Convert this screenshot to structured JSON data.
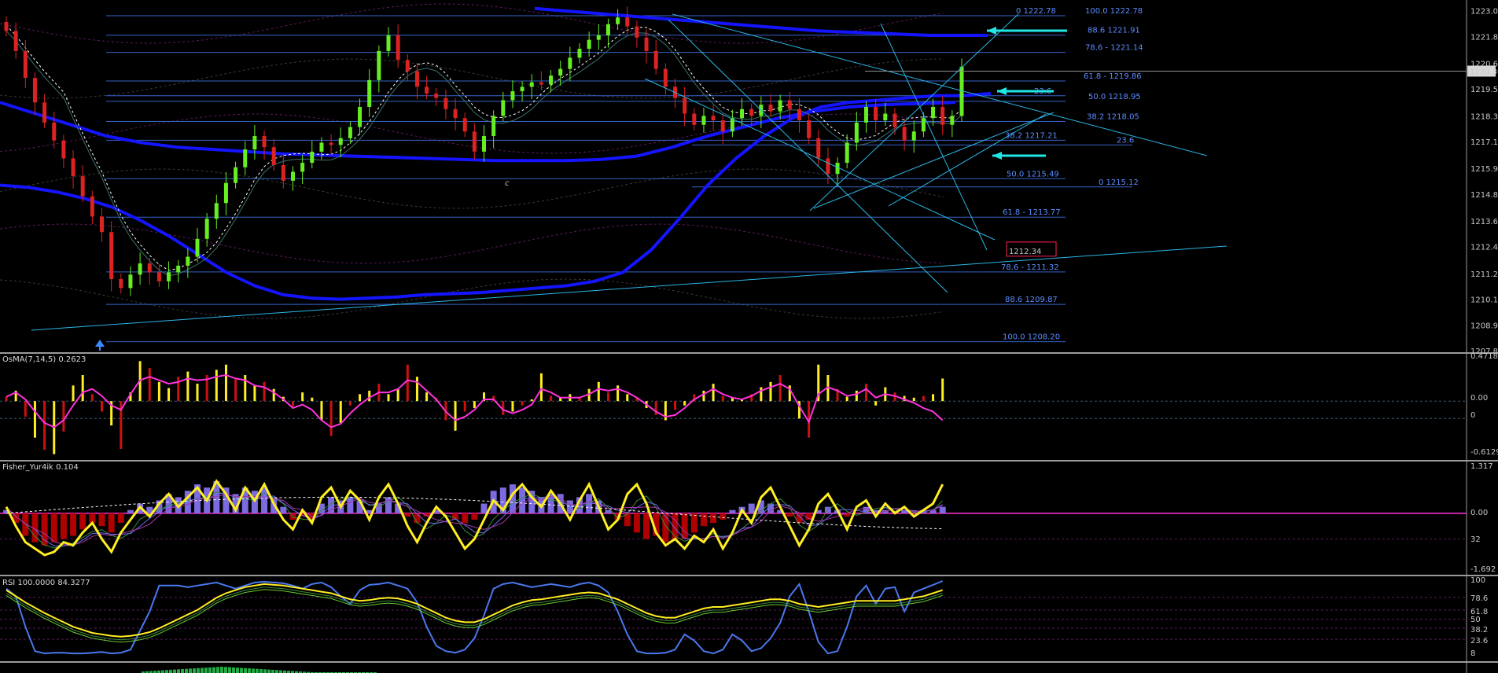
{
  "chart_data": [
    {
      "type": "candlestick",
      "pane": "main",
      "ylim": [
        1207.8,
        1223.2
      ],
      "y_ticks": [
        "1223.00",
        "1221.85",
        "1220.65",
        "1219.50",
        "1218.30",
        "1217.15",
        "1215.95",
        "1214.80",
        "1213.60",
        "1212.45",
        "1211.25",
        "1210.10",
        "1208.95",
        "1207.80"
      ],
      "current_price": "1220.30",
      "price_marker": "1212.34",
      "wave_label": "c",
      "fib_levels": [
        {
          "label": "0  1222.78",
          "value": 1222.78
        },
        {
          "label": "100.0  1222.78",
          "value": 1222.78
        },
        {
          "label": "88.6  1221.91",
          "value": 1221.91
        },
        {
          "label": "78.6 - 1221.14",
          "value": 1221.14
        },
        {
          "label": "61.8 - 1219.86",
          "value": 1219.86
        },
        {
          "label": "23.6",
          "value": 1219.2
        },
        {
          "label": "50.0  1218.95",
          "value": 1218.95
        },
        {
          "label": "38.2  1218.05",
          "value": 1218.05
        },
        {
          "label": "38.2  1217.21",
          "value": 1217.21
        },
        {
          "label": "23.6",
          "value": 1217.0
        },
        {
          "label": "50.0  1215.49",
          "value": 1215.49
        },
        {
          "label": "0  1215.12",
          "value": 1215.12
        },
        {
          "label": "61.8 - 1213.77",
          "value": 1213.77
        },
        {
          "label": "78.6 - 1211.32",
          "value": 1211.32
        },
        {
          "label": "88.6  1209.87",
          "value": 1209.87
        },
        {
          "label": "100.0  1208.20",
          "value": 1208.2
        }
      ],
      "close_series": [
        1222.1,
        1221.2,
        1220.0,
        1218.9,
        1218.0,
        1217.2,
        1216.4,
        1215.6,
        1214.7,
        1213.8,
        1213.1,
        1211.0,
        1210.6,
        1211.2,
        1211.7,
        1211.3,
        1210.9,
        1211.3,
        1211.6,
        1212.0,
        1212.8,
        1213.7,
        1214.4,
        1215.3,
        1216.0,
        1216.8,
        1217.4,
        1216.9,
        1216.1,
        1215.4,
        1215.8,
        1216.2,
        1216.7,
        1217.1,
        1217.0,
        1217.3,
        1217.8,
        1218.7,
        1219.9,
        1221.2,
        1221.9,
        1220.8,
        1220.3,
        1219.6,
        1219.3,
        1219.1,
        1218.6,
        1218.2,
        1217.6,
        1216.7,
        1217.4,
        1218.3,
        1219.0,
        1219.4,
        1219.6,
        1219.8,
        1219.7,
        1220.1,
        1220.4,
        1220.9,
        1221.3,
        1221.7,
        1221.9,
        1222.4,
        1222.7,
        1222.3,
        1221.8,
        1221.2,
        1220.4,
        1219.6,
        1219.1,
        1218.4,
        1217.9,
        1218.3,
        1218.1,
        1217.6,
        1218.2,
        1218.6,
        1218.3,
        1218.8,
        1218.5,
        1219.0,
        1218.6,
        1218.1,
        1217.3,
        1216.4,
        1215.7,
        1216.2,
        1217.1,
        1218.0,
        1218.7,
        1218.1,
        1218.4,
        1217.8,
        1217.2,
        1217.6,
        1218.2,
        1218.7,
        1217.9,
        1218.3,
        1220.5
      ],
      "ma_blue": [
        1215.2,
        1215.1,
        1214.9,
        1214.6,
        1214.2,
        1213.6,
        1212.9,
        1212.1,
        1211.3,
        1210.7,
        1210.3,
        1210.15,
        1210.1,
        1210.15,
        1210.2,
        1210.3,
        1210.35,
        1210.4,
        1210.5,
        1210.6,
        1210.7,
        1210.9,
        1211.3,
        1212.3,
        1213.7,
        1215.2,
        1216.4,
        1217.4,
        1218.2,
        1218.7,
        1218.9,
        1219.0,
        1219.1,
        1219.2,
        1219.2,
        1219.3
      ],
      "ma_blue_top": [
        1223.1,
        1223.0,
        1222.9,
        1222.8,
        1222.7,
        1222.6,
        1222.5,
        1222.4,
        1222.3,
        1222.2,
        1222.1,
        1222.05,
        1222.0,
        1221.95,
        1221.9,
        1221.9,
        1221.9
      ],
      "ma_blue_low": [
        1218.9,
        1218.4,
        1217.9,
        1217.4,
        1217.1,
        1216.9,
        1216.8,
        1216.7,
        1216.6,
        1216.55,
        1216.5,
        1216.45,
        1216.4,
        1216.35,
        1216.3,
        1216.3,
        1216.3,
        1216.35,
        1216.5,
        1216.9,
        1217.4,
        1217.8,
        1218.2,
        1218.5,
        1218.7,
        1218.8,
        1218.85,
        1218.9
      ]
    },
    {
      "type": "bar",
      "pane": "osma",
      "title": "OsMA(7,14,5) 0.2623",
      "y_ticks": [
        "0.4718",
        "0.00",
        "0",
        "-0.6129"
      ],
      "ylim": [
        -0.6129,
        0.4718
      ],
      "histogram": [
        0.05,
        0.12,
        -0.18,
        -0.42,
        -0.56,
        -0.61,
        -0.35,
        0.18,
        0.3,
        0.08,
        -0.12,
        -0.28,
        -0.55,
        0.1,
        0.46,
        0.38,
        0.22,
        0.15,
        0.28,
        0.34,
        0.2,
        0.3,
        0.36,
        0.42,
        0.25,
        0.3,
        0.18,
        0.22,
        0.14,
        0.05,
        -0.06,
        0.1,
        0.04,
        -0.22,
        -0.4,
        -0.25,
        -0.05,
        0.08,
        0.12,
        0.2,
        0.08,
        0.14,
        0.42,
        0.28,
        0.1,
        0.04,
        -0.22,
        -0.34,
        -0.12,
        -0.08,
        0.1,
        0.06,
        -0.16,
        -0.12,
        -0.05,
        0.02,
        0.32,
        0.06,
        0.04,
        0.08,
        0.05,
        0.14,
        0.22,
        0.1,
        0.18,
        0.08,
        0.04,
        -0.08,
        -0.16,
        -0.22,
        -0.1,
        -0.05,
        0.08,
        0.12,
        0.2,
        0.06,
        0.04,
        0.02,
        0.08,
        0.16,
        0.22,
        0.3,
        0.18,
        -0.2,
        -0.42,
        0.42,
        0.3,
        0.14,
        0.05,
        0.12,
        0.2,
        -0.05,
        0.16,
        0.1,
        0.06,
        0.04,
        0.06,
        0.08,
        0.26
      ],
      "signal": [
        0.05,
        0.1,
        0.02,
        -0.12,
        -0.25,
        -0.3,
        -0.22,
        -0.05,
        0.1,
        0.14,
        0.06,
        -0.05,
        -0.1,
        0.08,
        0.24,
        0.28,
        0.24,
        0.2,
        0.22,
        0.26,
        0.24,
        0.25,
        0.28,
        0.3,
        0.26,
        0.24,
        0.18,
        0.16,
        0.1,
        0.02,
        -0.08,
        -0.04,
        -0.1,
        -0.22,
        -0.3,
        -0.26,
        -0.14,
        -0.04,
        0.04,
        0.1,
        0.1,
        0.14,
        0.24,
        0.22,
        0.12,
        0.02,
        -0.12,
        -0.22,
        -0.18,
        -0.1,
        0.02,
        0.02,
        -0.1,
        -0.14,
        -0.1,
        -0.04,
        0.14,
        0.1,
        0.04,
        0.04,
        0.04,
        0.08,
        0.14,
        0.12,
        0.14,
        0.1,
        0.04,
        -0.04,
        -0.12,
        -0.18,
        -0.16,
        -0.08,
        0.02,
        0.08,
        0.14,
        0.08,
        0.04,
        0.02,
        0.06,
        0.12,
        0.16,
        0.2,
        0.14,
        -0.06,
        -0.24,
        0.08,
        0.16,
        0.12,
        0.06,
        0.08,
        0.14,
        0.04,
        0.08,
        0.06,
        0.02,
        -0.02,
        -0.08,
        -0.12,
        -0.22
      ]
    },
    {
      "type": "line",
      "pane": "fisher",
      "title": "Fisher_Yur4ik 0.104",
      "y_ticks": [
        "1.317",
        "0.00",
        "32",
        "-1.692"
      ],
      "ylim": [
        -1.692,
        1.317
      ],
      "fisher": [
        0.2,
        -0.4,
        -0.9,
        -1.1,
        -1.3,
        -1.2,
        -0.9,
        -1.0,
        -0.6,
        -0.3,
        -0.8,
        -1.2,
        -0.6,
        -0.2,
        0.2,
        -0.1,
        0.3,
        0.6,
        0.2,
        0.5,
        0.8,
        0.4,
        1.0,
        0.6,
        0.1,
        0.8,
        0.4,
        0.9,
        0.3,
        -0.2,
        -0.5,
        0.1,
        -0.3,
        0.5,
        0.8,
        0.2,
        0.7,
        0.4,
        -0.2,
        0.5,
        0.9,
        0.3,
        -0.4,
        -0.9,
        -0.3,
        0.2,
        -0.1,
        -0.6,
        -1.1,
        -0.8,
        -0.2,
        0.4,
        0.1,
        0.6,
        0.9,
        0.5,
        0.2,
        0.7,
        0.3,
        -0.2,
        0.4,
        0.9,
        0.2,
        -0.5,
        -0.2,
        0.6,
        0.9,
        0.3,
        -0.6,
        -1.0,
        -0.8,
        -1.1,
        -0.7,
        -0.9,
        -0.5,
        -1.1,
        -0.6,
        0.1,
        -0.3,
        0.5,
        0.8,
        0.2,
        -0.4,
        -1.0,
        -0.5,
        0.3,
        0.6,
        0.1,
        -0.5,
        0.2,
        0.4,
        -0.1,
        0.3,
        0.0,
        0.2,
        -0.1,
        0.1,
        0.3,
        0.9
      ],
      "histogram": [
        0.1,
        -0.3,
        -0.7,
        -0.9,
        -1.0,
        -0.9,
        -0.8,
        -0.7,
        -0.5,
        -0.3,
        -0.4,
        -0.6,
        -0.3,
        0.1,
        0.3,
        0.2,
        0.4,
        0.6,
        0.5,
        0.7,
        0.9,
        0.8,
        1.0,
        0.8,
        0.6,
        0.8,
        0.7,
        0.8,
        0.5,
        0.2,
        -0.2,
        -0.1,
        -0.2,
        0.3,
        0.5,
        0.4,
        0.5,
        0.4,
        0.1,
        0.3,
        0.5,
        0.3,
        -0.1,
        -0.3,
        -0.1,
        0.1,
        0.0,
        -0.2,
        -0.3,
        -0.2,
        0.3,
        0.7,
        0.8,
        0.9,
        0.8,
        0.7,
        0.5,
        0.6,
        0.6,
        0.4,
        0.5,
        0.6,
        0.4,
        0.1,
        -0.2,
        -0.4,
        -0.6,
        -0.8,
        -0.7,
        -0.9,
        -0.8,
        -0.8,
        -0.6,
        -0.4,
        -0.3,
        -0.2,
        0.1,
        0.2,
        0.3,
        0.4,
        0.3,
        0.1,
        -0.1,
        -0.3,
        -0.2,
        0.1,
        0.2,
        0.1,
        -0.1,
        0.0,
        0.2,
        0.1,
        0.1,
        0.0,
        0.1,
        0.0,
        0.1,
        0.1,
        0.2
      ],
      "color_up": "#7b6ae0",
      "color_down": "#b00000"
    },
    {
      "type": "line",
      "pane": "rsi",
      "title": "RSI 100.0000 84.3277",
      "y_ticks": [
        "100",
        "78.6",
        "61.8",
        "50",
        "38.2",
        "23.6",
        "8"
      ],
      "ylim": [
        0,
        100
      ],
      "rsi": [
        90,
        80,
        40,
        8,
        5,
        6,
        6,
        5,
        5,
        6,
        7,
        5,
        6,
        10,
        35,
        60,
        94,
        94,
        94,
        92,
        94,
        96,
        98,
        94,
        90,
        94,
        98,
        99,
        98,
        97,
        94,
        90,
        96,
        98,
        92,
        80,
        70,
        88,
        95,
        96,
        98,
        94,
        90,
        72,
        40,
        15,
        8,
        6,
        10,
        25,
        55,
        90,
        96,
        98,
        95,
        92,
        94,
        96,
        94,
        92,
        96,
        98,
        94,
        85,
        60,
        30,
        8,
        5,
        5,
        6,
        10,
        30,
        22,
        8,
        5,
        10,
        30,
        22,
        8,
        12,
        25,
        45,
        80,
        96,
        60,
        20,
        5,
        8,
        40,
        80,
        94,
        70,
        90,
        92,
        60,
        85,
        90,
        95,
        100
      ],
      "yellow": [
        88,
        80,
        72,
        65,
        58,
        52,
        46,
        40,
        36,
        32,
        30,
        28,
        27,
        28,
        30,
        33,
        38,
        44,
        50,
        56,
        62,
        70,
        78,
        84,
        88,
        92,
        94,
        96,
        95,
        94,
        92,
        90,
        88,
        86,
        84,
        80,
        76,
        74,
        75,
        77,
        78,
        77,
        74,
        70,
        64,
        58,
        52,
        48,
        46,
        46,
        50,
        56,
        62,
        68,
        72,
        75,
        76,
        78,
        80,
        82,
        84,
        85,
        84,
        80,
        76,
        70,
        64,
        58,
        54,
        52,
        52,
        56,
        60,
        64,
        66,
        66,
        68,
        70,
        72,
        74,
        76,
        76,
        74,
        70,
        68,
        66,
        68,
        70,
        72,
        74,
        74,
        74,
        74,
        74,
        76,
        78,
        80,
        84,
        88
      ]
    }
  ],
  "colors": {
    "bg": "#000000",
    "candle_up": "#66ee22",
    "candle_down": "#dd2222",
    "ma_blue": "#1414ff",
    "trendline": "#2ab6e6",
    "fib": "#3464c8",
    "magenta": "#ff33dd",
    "yellow": "#ffee22",
    "osma_up": "#ffee22",
    "osma_down": "#cc1111",
    "arrow": "#22e6e6",
    "marker": "#ff2255"
  }
}
